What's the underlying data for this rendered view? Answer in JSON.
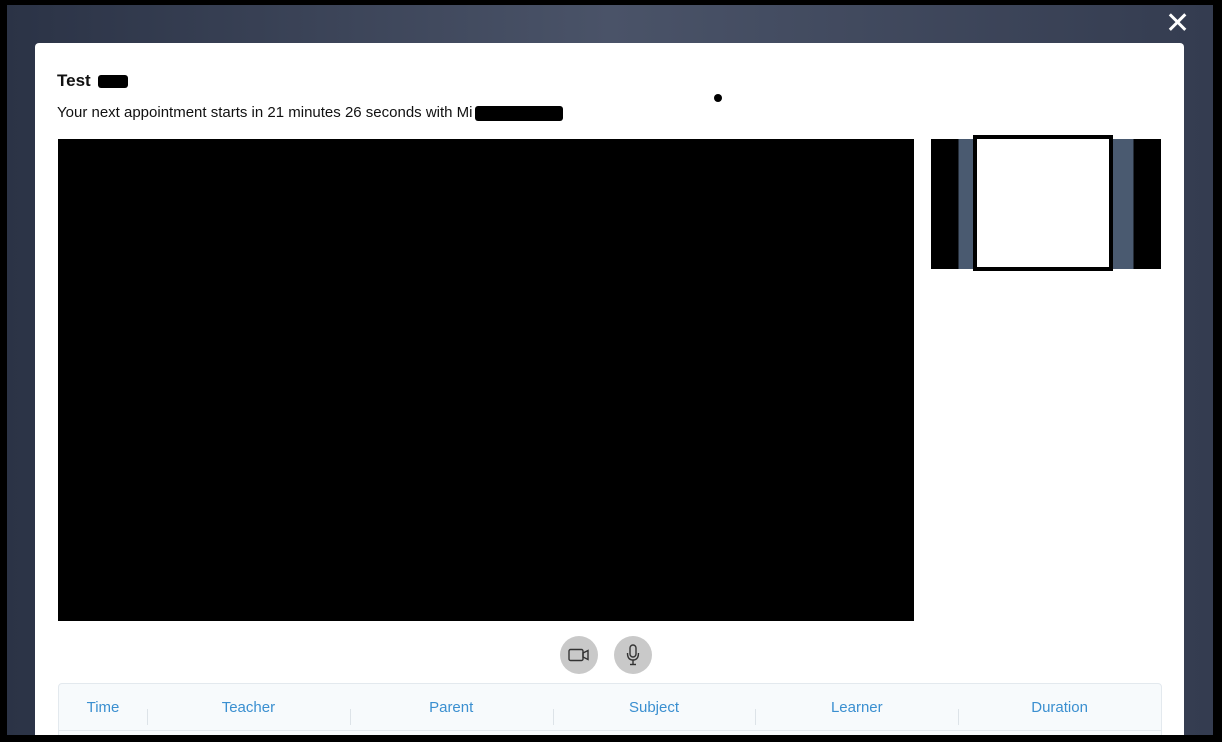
{
  "modal": {
    "title": "Test",
    "subtitle": "Your next appointment starts in 21 minutes 26 seconds with Mi"
  },
  "controls": {
    "camera_icon": "video-camera-icon",
    "mic_icon": "microphone-icon"
  },
  "table": {
    "columns": [
      "Time",
      "Teacher",
      "Parent",
      "Subject",
      "Learner",
      "Duration"
    ]
  },
  "colors": {
    "header_text": "#3a8fd0",
    "backdrop": "#3f475b"
  }
}
